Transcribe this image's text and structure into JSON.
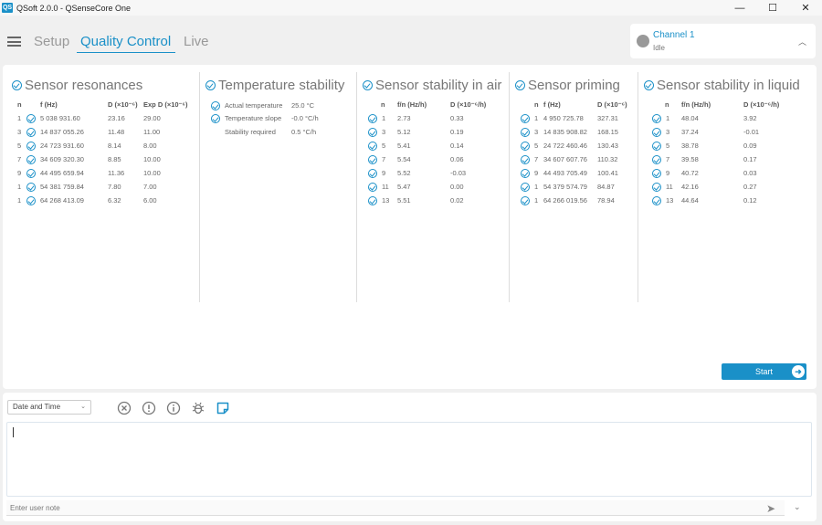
{
  "window": {
    "logo": "QS",
    "title": "QSoft 2.0.0 - QSenseCore One",
    "minimize": "—",
    "maximize": "☐",
    "close": "✕"
  },
  "nav": {
    "tabs": [
      {
        "label": "Setup"
      },
      {
        "label": "Quality Control"
      },
      {
        "label": "Live"
      }
    ]
  },
  "channel": {
    "name": "Channel 1",
    "status": "Idle"
  },
  "sections": {
    "resonances": {
      "title": "Sensor resonances",
      "headers": [
        "n",
        "f (Hz)",
        "D (×10⁻⁶)",
        "Exp D (×10⁻⁶)"
      ],
      "rows": [
        [
          "1",
          "5 038 931.60",
          "23.16",
          "29.00"
        ],
        [
          "3",
          "14 837 055.26",
          "11.48",
          "11.00"
        ],
        [
          "5",
          "24 723 931.60",
          "8.14",
          "8.00"
        ],
        [
          "7",
          "34 609 320.30",
          "8.85",
          "10.00"
        ],
        [
          "9",
          "44 495 659.94",
          "11.36",
          "10.00"
        ],
        [
          "1",
          "54 381 759.84",
          "7.80",
          "7.00"
        ],
        [
          "1",
          "64 268 413.09",
          "6.32",
          "6.00"
        ]
      ]
    },
    "temperature": {
      "title": "Temperature stability",
      "rows": [
        {
          "label": "Actual temperature",
          "value": "25.0 °C",
          "checked": true
        },
        {
          "label": "Temperature slope",
          "value": "-0.0 °C/h",
          "checked": true
        },
        {
          "label": "Stability required",
          "value": "0.5 °C/h",
          "checked": false
        }
      ]
    },
    "air": {
      "title": "Sensor stability in air",
      "headers": [
        "n",
        "f/n (Hz/h)",
        "D (×10⁻⁶/h)"
      ],
      "rows": [
        [
          "1",
          "2.73",
          "0.33"
        ],
        [
          "3",
          "5.12",
          "0.19"
        ],
        [
          "5",
          "5.41",
          "0.14"
        ],
        [
          "7",
          "5.54",
          "0.06"
        ],
        [
          "9",
          "5.52",
          "-0.03"
        ],
        [
          "11",
          "5.47",
          "0.00"
        ],
        [
          "13",
          "5.51",
          "0.02"
        ]
      ]
    },
    "priming": {
      "title": "Sensor priming",
      "headers": [
        "n",
        "f (Hz)",
        "D (×10⁻⁶)"
      ],
      "rows": [
        [
          "1",
          "4 950 725.78",
          "327.31"
        ],
        [
          "3",
          "14 835 908.82",
          "168.15"
        ],
        [
          "5",
          "24 722 460.46",
          "130.43"
        ],
        [
          "7",
          "34 607 607.76",
          "110.32"
        ],
        [
          "9",
          "44 493 705.49",
          "100.41"
        ],
        [
          "1",
          "54 379 574.79",
          "84.87"
        ],
        [
          "1",
          "64 266 019.56",
          "78.94"
        ]
      ]
    },
    "liquid": {
      "title": "Sensor stability in liquid",
      "headers": [
        "n",
        "f/n (Hz/h)",
        "D (×10⁻⁶/h)"
      ],
      "rows": [
        [
          "1",
          "48.04",
          "3.92"
        ],
        [
          "3",
          "37.24",
          "-0.01"
        ],
        [
          "5",
          "38.78",
          "0.09"
        ],
        [
          "7",
          "39.58",
          "0.17"
        ],
        [
          "9",
          "40.72",
          "0.03"
        ],
        [
          "11",
          "42.16",
          "0.27"
        ],
        [
          "13",
          "44.64",
          "0.12"
        ]
      ]
    }
  },
  "start_button": {
    "label": "Start",
    "arrow": "➜"
  },
  "log": {
    "filter": {
      "selected": "Date and Time",
      "arrow": "⌄"
    },
    "note_placeholder": "Enter user note",
    "send": "➤",
    "collapse": "⌄"
  },
  "colors": {
    "accent": "#1a90c8",
    "background": "#f0f0f0",
    "panel": "#ffffff"
  }
}
